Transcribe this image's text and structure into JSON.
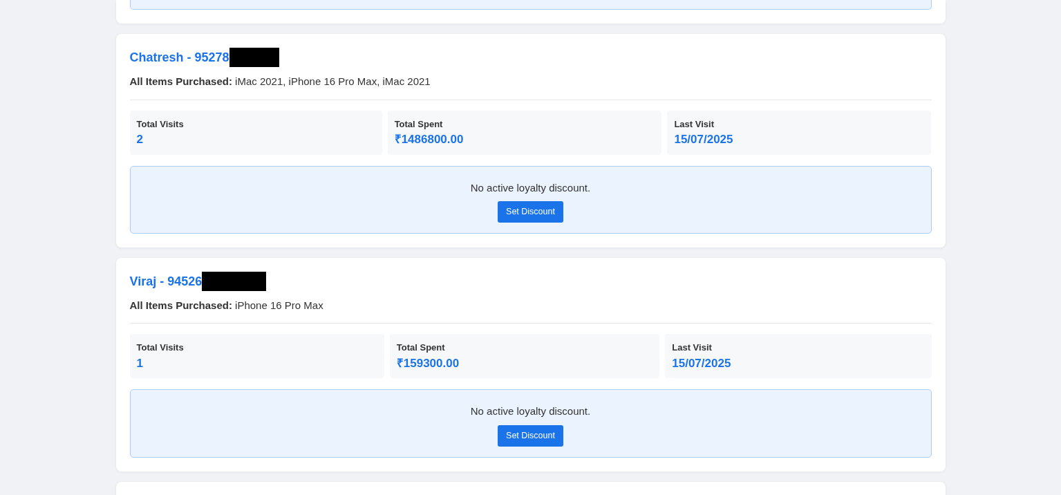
{
  "customers": [
    {
      "title": "Chatresh - 95278",
      "redacted": true,
      "items_purchased": "**All Items Purchased:** iMac 2021, iPhone 16 Pro Max, iMac 2021",
      "stats": [
        {
          "label": "Total Visits",
          "value": "2"
        },
        {
          "label": "Total Spent",
          "value": "₹1486800.00"
        },
        {
          "label": "Last Visit",
          "value": "15/07/2025"
        }
      ],
      "discount_message": "No active loyalty discount.",
      "button": "Set Discount"
    },
    {
      "title": "Viraj - 94526",
      "redacted": true,
      "items_purchased": "**All Items Purchased:** iPhone 16 Pro Max",
      "stats": [
        {
          "label": "Total Visits",
          "value": "1"
        },
        {
          "label": "Total Spent",
          "value": "₹159300.00"
        },
        {
          "label": "Last Visit",
          "value": "15/07/2025"
        }
      ],
      "discount_message": "No active loyalty discount.",
      "button": "Set Discount"
    }
  ]
}
